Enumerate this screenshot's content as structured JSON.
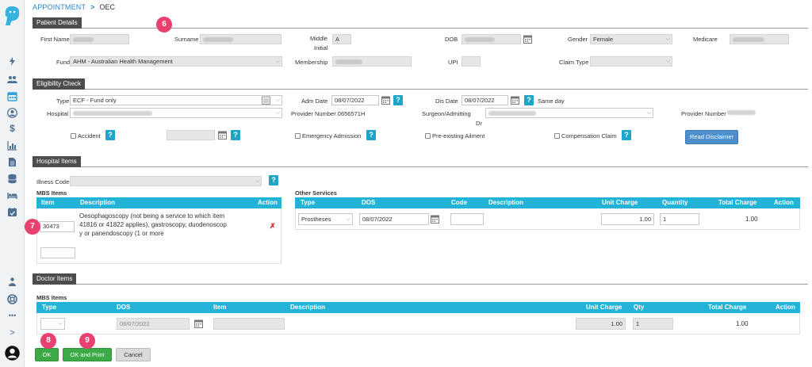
{
  "breadcrumb": {
    "parent": "APPOINTMENT",
    "separator": ">",
    "current": "OEC"
  },
  "badges": {
    "b6": "6",
    "b7": "7",
    "b8": "8",
    "b9": "9"
  },
  "patient": {
    "section_title": "Patient Details",
    "first_name_label": "First Name",
    "surname_label": "Surname",
    "middle_initial_label_1": "Middle",
    "middle_initial_label_2": "Initial",
    "middle_initial_value": "A",
    "dob_label": "DOB",
    "gender_label": "Gender",
    "gender_value": "Female",
    "medicare_label": "Medicare",
    "fund_label": "Fund",
    "fund_value": "AHM - Australian Health Management",
    "membership_label": "Membership",
    "upi_label": "UPI",
    "claim_type_label": "Claim Type",
    "claim_type_value": ""
  },
  "eligibility": {
    "section_title": "Eligibility Check",
    "type_label": "Type",
    "type_value": "ECF - Fund only",
    "adm_date_label": "Adm Date",
    "adm_date_value": "08/07/2022",
    "dis_date_label": "Dis Date",
    "dis_date_value": "08/07/2022",
    "same_day_label": "Same day",
    "hospital_label": "Hospital",
    "provider_number_label": "Provider Number 0656571H",
    "surgeon_label_1": "Surgeon/Admitting",
    "surgeon_label_2": "Dr",
    "provider_number_label_2": "Provider Number",
    "accident_label": "Accident",
    "emergency_label": "Emergency Admission",
    "preexisting_label": "Pre-existing Ailment",
    "compensation_label": "Compensation Claim",
    "read_disclaimer_label": "Read Disclaimer"
  },
  "hospital_items": {
    "section_title": "Hospital Items",
    "illness_code_label": "Illness Code",
    "mbs_title": "MBS Items",
    "mbs_columns": {
      "item": "Item",
      "description": "Description",
      "action": "Action"
    },
    "mbs_row": {
      "item": "30473",
      "description_lines": [
        "Oesophagoscopy (not being a service to which item",
        "41816 or 41822 applies), gastroscopy, duodenoscop",
        "y or panendoscopy (1 or more"
      ],
      "action": "✗"
    },
    "other_title": "Other Services",
    "other_columns": {
      "type": "Type",
      "dos": "DOS",
      "code": "Code",
      "description": "Description",
      "unit_charge": "Unit Charge",
      "quantity": "Quantity",
      "total_charge": "Total Charge",
      "action": "Action"
    },
    "other_row": {
      "type": "Prostheses",
      "dos": "08/07/2022",
      "code": "",
      "unit_charge": "1.00",
      "quantity": "1",
      "total_charge": "1.00"
    }
  },
  "doctor_items": {
    "section_title": "Doctor Items",
    "mbs_title": "MBS Items",
    "columns": {
      "type": "Type",
      "dos": "DOS",
      "item": "Item",
      "description": "Description",
      "unit_charge": "Unit Charge",
      "qty": "Qty",
      "total_charge": "Total Charge",
      "action": "Action"
    },
    "row": {
      "type": "",
      "dos": "08/07/2022",
      "item": "",
      "unit_charge": "1.00",
      "qty": "1",
      "total_charge": "1.00"
    }
  },
  "buttons": {
    "ok": "OK",
    "ok_print": "OK and Print",
    "cancel": "Cancel"
  },
  "sidebar": {
    "icons": [
      "bolt-icon",
      "users-icon",
      "calendar-icon",
      "user-circle-icon",
      "dollar-icon",
      "bar-chart-icon",
      "document-icon",
      "database-icon",
      "bed-icon",
      "calendar-check-icon",
      "user-group-icon",
      "help-ring-icon",
      "more-icon",
      "expand-icon",
      "profile-icon"
    ],
    "more_label": "•••",
    "expand_label": ">"
  },
  "colors": {
    "accent": "#23b3d7",
    "section": "#4d4d4d",
    "link": "#2f86c5",
    "ok": "#3daa48",
    "badge": "#e8416f",
    "disclaimer": "#4d8ecb"
  }
}
